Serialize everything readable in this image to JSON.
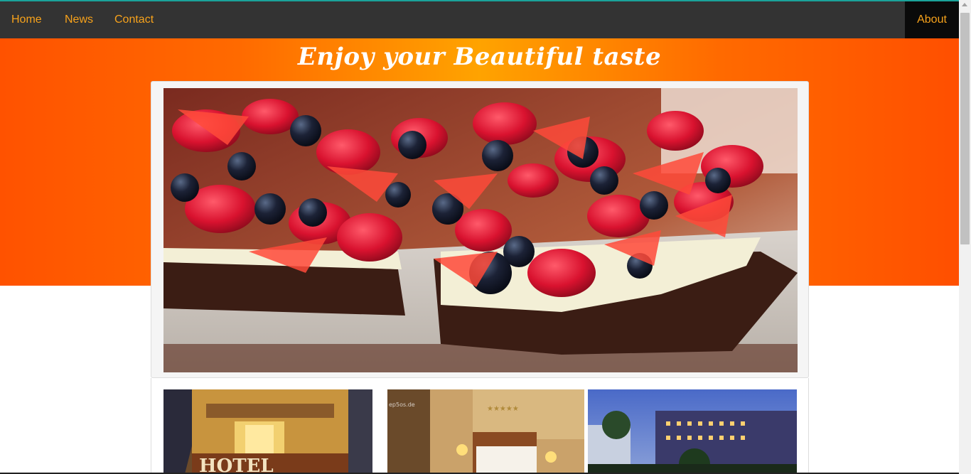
{
  "nav": {
    "home": "Home",
    "news": "News",
    "contact": "Contact",
    "about": "About"
  },
  "hero": {
    "title": "Enjoy your Beautiful taste"
  },
  "colors": {
    "nav_bg": "#333333",
    "nav_text": "#f7a21b",
    "active_bg": "#0a0a0a",
    "hero_orange": "#ff5200",
    "hero_yellow": "#ffa300"
  },
  "images": {
    "feature": "berry-brownie-pizza",
    "thumbs": [
      "hotel-facade",
      "hotel-room",
      "hotel-exterior-dusk"
    ],
    "thumb_room_watermark": "ep5os.de"
  }
}
